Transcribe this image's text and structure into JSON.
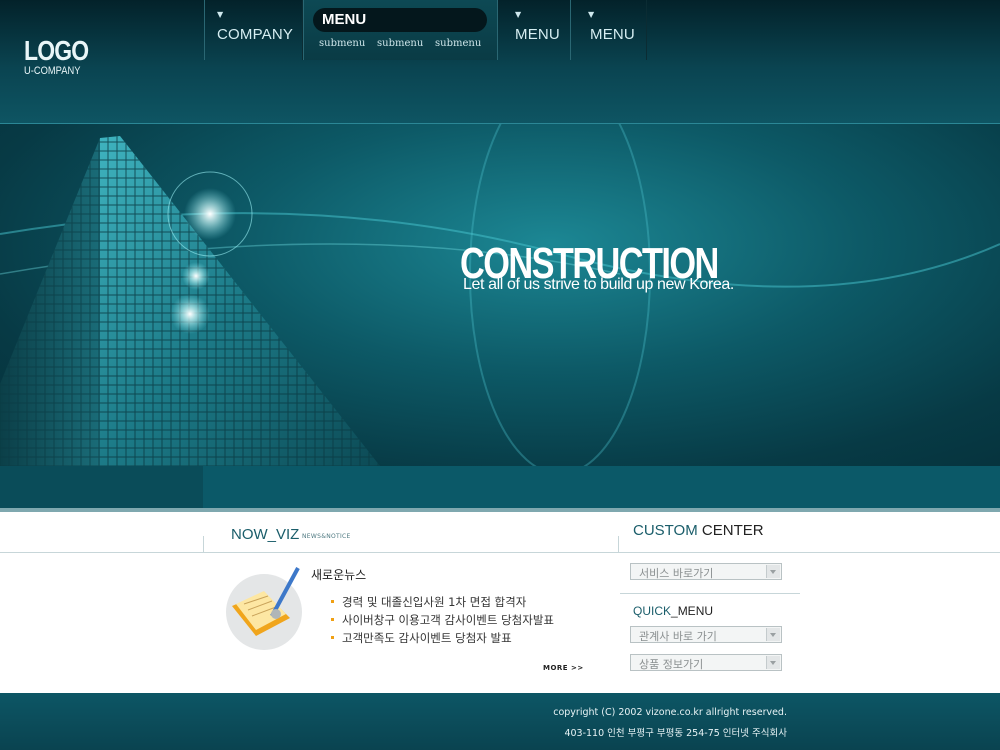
{
  "logo": {
    "text": "LOGO",
    "subtext": "U-COMPANY"
  },
  "nav": {
    "company": "COMPANY",
    "active_menu": "MENU",
    "submenus": [
      "submenu",
      "submenu",
      "submenu"
    ],
    "menu2": "MENU",
    "menu3": "MENU"
  },
  "hero": {
    "title": "CONSTRUCTION",
    "subtitle": "Let all of us strive to build up  new Korea."
  },
  "news": {
    "section_title": "NOW_VIZ",
    "section_subtitle": "NEWS&NOTICE",
    "heading": "새로운뉴스",
    "items": [
      "경력 및 대졸신입사원 1차 면접 합격자",
      "사이버창구 이용고객 감사이벤트 당첨자발표",
      "고객만족도 감사이벤트 당첨자 발표"
    ],
    "more_label": "MORE >>"
  },
  "custom_center": {
    "title_a": "CUSTOM",
    "title_b": " CENTER",
    "service_select": "서비스 바로가기"
  },
  "quick_menu": {
    "title_a": "QUICK",
    "title_b": "_MENU",
    "affiliate_select": "관계사 바로 가기",
    "product_select": "상품 정보가기"
  },
  "footer": {
    "copyright": "copyright (C) 2002 vizone.co.kr allright reserved.",
    "address": "403-110  인천 부평구  부평동 254-75  인터넷 주식회사"
  },
  "colors": {
    "primary": "#0b5968",
    "accent": "#1a5d6a",
    "bullet": "#f0a013"
  }
}
